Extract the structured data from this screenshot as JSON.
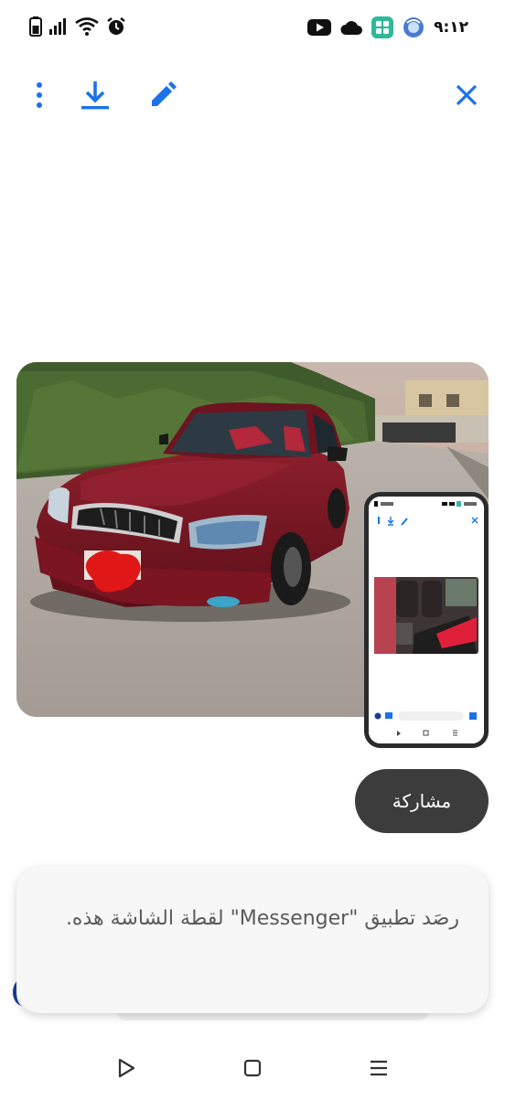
{
  "status_bar": {
    "time": "٩:١٢",
    "left_icons": [
      "battery-icon",
      "signal-icon",
      "wifi-icon",
      "alarm-icon"
    ],
    "right_icons": [
      "youtube-icon",
      "cloud-icon",
      "app-grid-icon",
      "assistant-icon"
    ]
  },
  "toolbar": {
    "items": [
      "more-vert-icon",
      "download-icon",
      "edit-icon",
      "close-icon"
    ],
    "accent_color": "#1a73e8"
  },
  "screenshot": {
    "description_icon": "screenshot-thumbnail"
  },
  "share_button": {
    "label": "مشاركة",
    "background": "#3c3c3c"
  },
  "snackbar": {
    "message": "رصَد تطبيق \"Messenger\" لقطة الشاشة هذه."
  },
  "nav_bar": {
    "items": [
      "back-icon",
      "home-icon",
      "recents-icon"
    ]
  }
}
